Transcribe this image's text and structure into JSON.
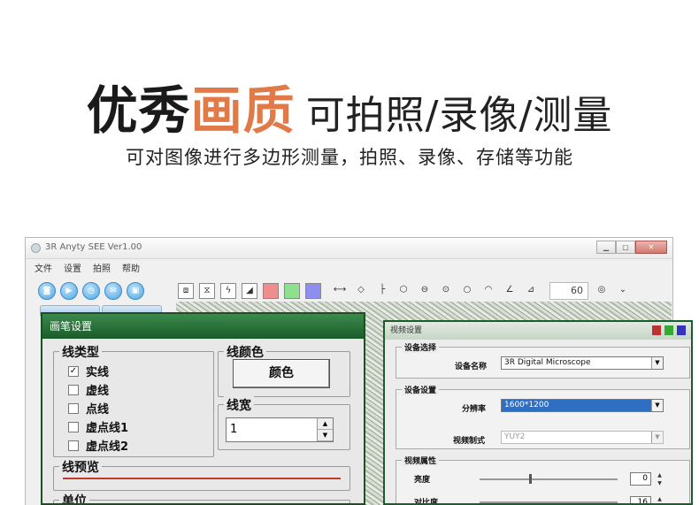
{
  "headline": {
    "part1": "优秀",
    "part2": "画质",
    "part3": "可拍照/录像/测量"
  },
  "subtitle": "可对图像进行多边形测量，拍照、录像、存储等功能",
  "app": {
    "title": "3R Anyty SEE Ver1.00",
    "menu": [
      "文件",
      "设置",
      "拍照",
      "帮助"
    ],
    "zoom_value": "60",
    "left_buttons": [
      "photo-icon",
      "video-icon",
      "clock-icon",
      "mail-icon",
      "lock-icon"
    ],
    "tools": [
      "fit-icon",
      "flip-icon",
      "lightning-icon",
      "contrast-icon",
      "red-swatch",
      "green-swatch",
      "blue-swatch",
      "hline-icon",
      "angle-icon",
      "line-end-icon",
      "hexagon-icon",
      "circle-center-icon",
      "circle-dot-icon",
      "circle-icon",
      "arc-icon",
      "angle-measure-icon",
      "slope-icon"
    ],
    "swatch_colors": {
      "red": "#f28d8d",
      "green": "#8de08d",
      "blue": "#8d8df2"
    }
  },
  "pen_dialog": {
    "title": "画笔设置",
    "line_type_label": "线类型",
    "line_types": [
      {
        "label": "实线",
        "checked": true
      },
      {
        "label": "虚线",
        "checked": false
      },
      {
        "label": "点线",
        "checked": false
      },
      {
        "label": "虚点线1",
        "checked": false
      },
      {
        "label": "虚点线2",
        "checked": false
      }
    ],
    "line_color_label": "线颜色",
    "color_button": "颜色",
    "line_width_label": "线宽",
    "line_width_value": "1",
    "preview_label": "线预览",
    "unit_label": "单位",
    "preview_color": "#c23a2a"
  },
  "video_dialog": {
    "title": "视频设置",
    "device_select_label": "设备选择",
    "device_name_label": "设备名称",
    "device_name_value": "3R Digital Microscope",
    "device_settings_label": "设备设置",
    "resolution_label": "分辨率",
    "resolution_value": "1600*1200",
    "video_format_label": "视频制式",
    "video_format_value": "YUY2",
    "video_props_label": "视频属性",
    "brightness_label": "亮度",
    "brightness_value": "0",
    "contrast_label": "对比度",
    "contrast_value": "16"
  }
}
